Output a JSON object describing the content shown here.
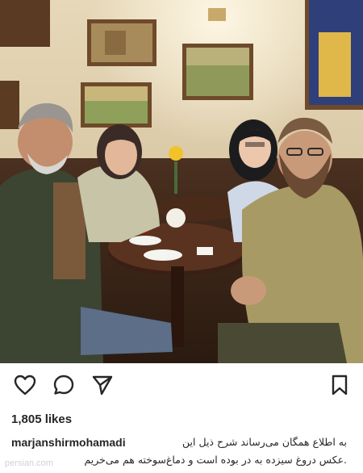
{
  "post": {
    "image_alt": "Group of four people seated around a small café table",
    "likes_text": "1,805 likes",
    "username": "marjanshirmohamadi",
    "caption_line1": "به اطلاع همگان می‌رساند شرح ذیل این",
    "caption_line2": ".عکس دروغ سیزده به در بوده است و دماغ‌سوخته هم می‌خریم",
    "watermark": "persian.com"
  },
  "icons": {
    "like": "heart-icon",
    "comment": "comment-bubble-icon",
    "share": "paper-plane-icon",
    "save": "bookmark-icon"
  },
  "colors": {
    "text": "#262626",
    "wall": "#d8c8a6",
    "wood": "#3b2417"
  }
}
